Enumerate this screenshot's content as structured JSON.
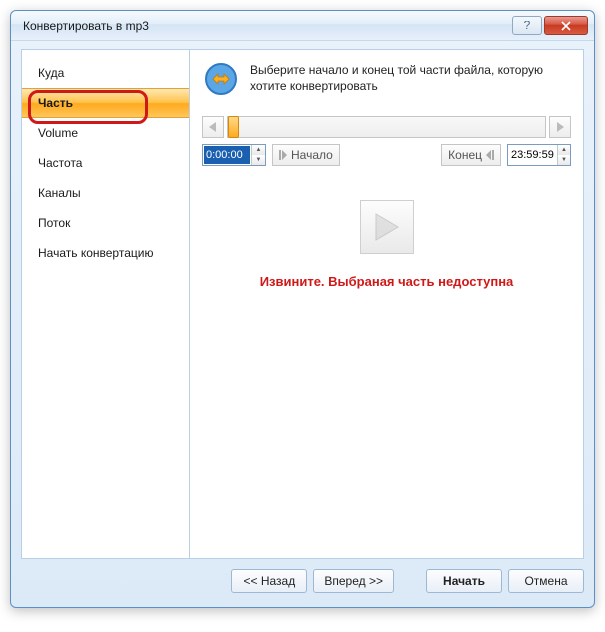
{
  "window": {
    "title": "Конвертировать в mp3"
  },
  "sidebar": {
    "items": [
      {
        "label": "Куда"
      },
      {
        "label": "Часть"
      },
      {
        "label": "Volume"
      },
      {
        "label": "Частота"
      },
      {
        "label": "Каналы"
      },
      {
        "label": "Поток"
      },
      {
        "label": "Начать конвертацию"
      }
    ],
    "active_index": 1
  },
  "main": {
    "instruction": "Выберите начало и конец той части файла, которую хотите конвертировать",
    "start_time": "0:00:00",
    "end_time": "23:59:59",
    "start_button": "Начало",
    "end_button": "Конец",
    "error": "Извините. Выбраная часть недоступна"
  },
  "footer": {
    "back": "<< Назад",
    "forward": "Вперед >>",
    "start": "Начать",
    "cancel": "Отмена"
  },
  "icons": {
    "help": "help-icon",
    "close": "close-icon"
  }
}
